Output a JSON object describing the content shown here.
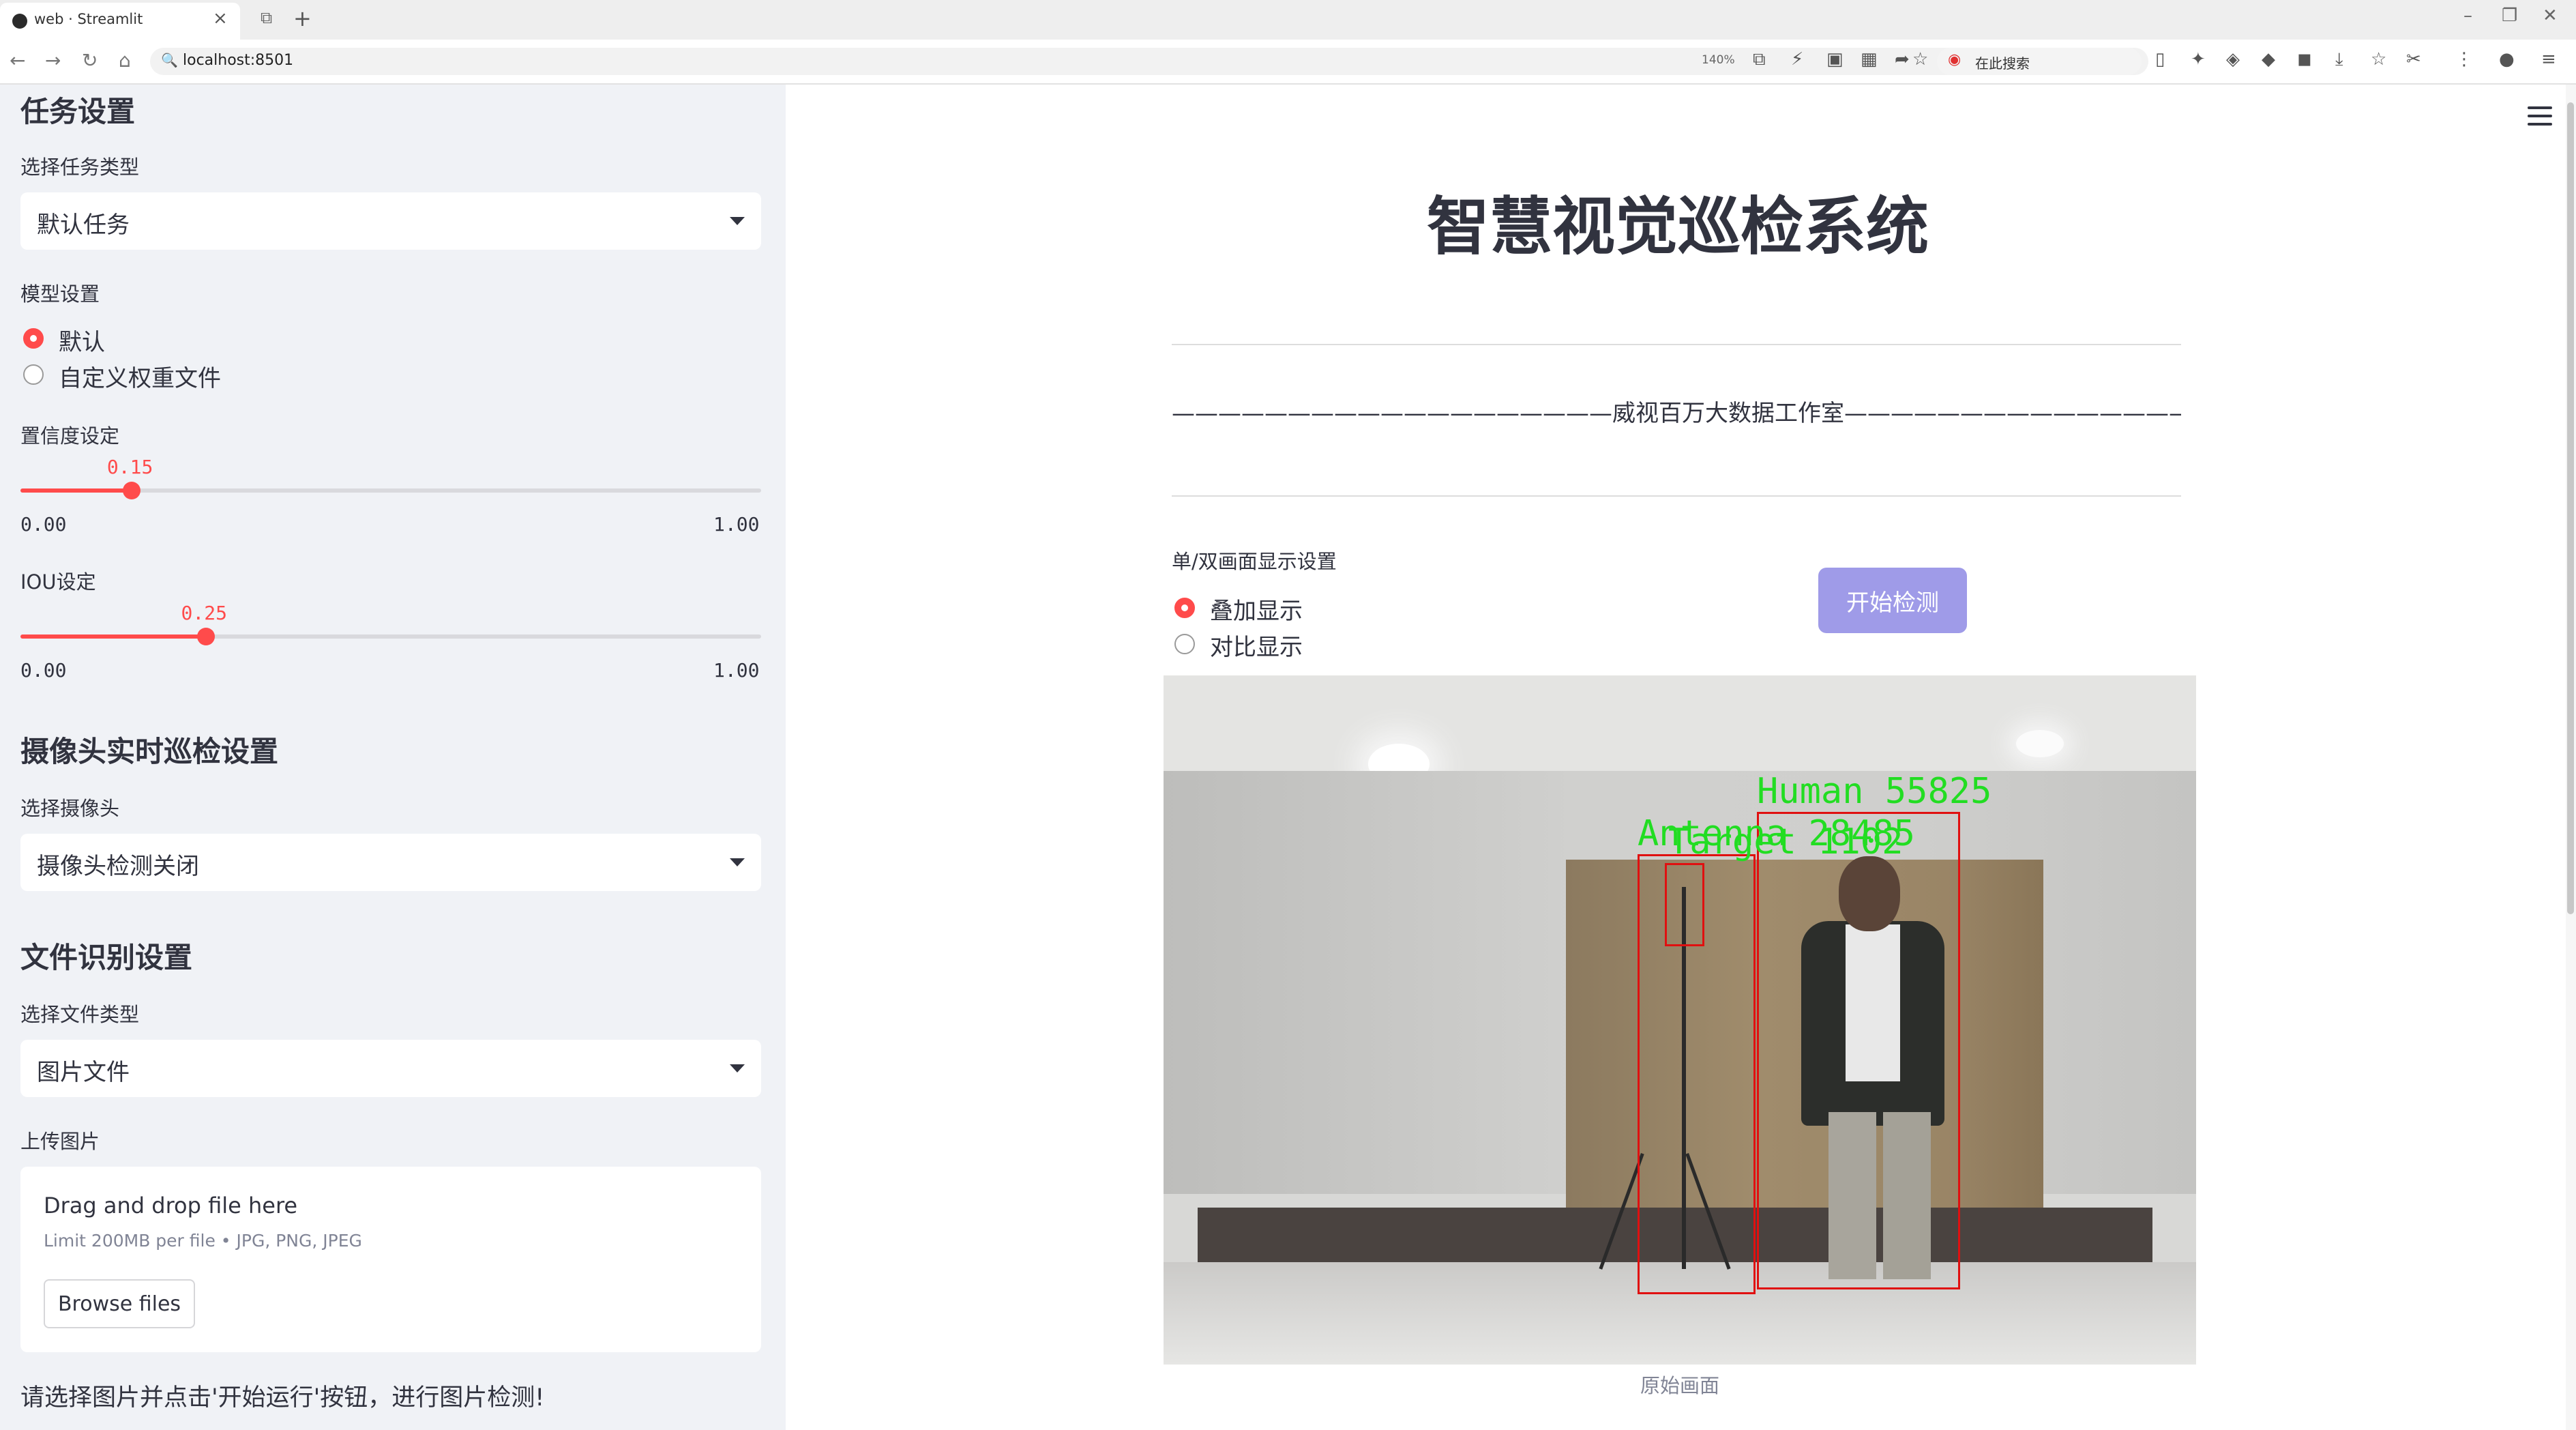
{
  "browser": {
    "tab_title": "web · Streamlit",
    "url": "localhost:8501",
    "zoom": "140%",
    "search_label": "在此搜索"
  },
  "sidebar": {
    "task_settings": {
      "header": "任务设置",
      "label": "选择任务类型",
      "value": "默认任务"
    },
    "model_settings": {
      "label": "模型设置",
      "options": [
        "默认",
        "自定义权重文件"
      ],
      "selected": "默认"
    },
    "confidence": {
      "label": "置信度设定",
      "value": "0.15",
      "min": "0.00",
      "max": "1.00",
      "fraction": 0.15
    },
    "iou": {
      "label": "IOU设定",
      "value": "0.25",
      "min": "0.00",
      "max": "1.00",
      "fraction": 0.25
    },
    "camera": {
      "header": "摄像头实时巡检设置",
      "label": "选择摄像头",
      "value": "摄像头检测关闭"
    },
    "file": {
      "header": "文件识别设置",
      "label": "选择文件类型",
      "value": "图片文件"
    },
    "upload": {
      "label": "上传图片",
      "drop_text": "Drag and drop file here",
      "limit_text": "Limit 200MB per file • JPG, PNG, JPEG",
      "browse_label": "Browse files"
    },
    "hint": "请选择图片并点击'开始运行'按钮，进行图片检测!"
  },
  "main": {
    "title": "智慧视觉巡检系统",
    "subtitle": "———————————————————威视百万大数据工作室——————————————————————",
    "display_mode": {
      "label": "单/双画面显示设置",
      "options": [
        "叠加显示",
        "对比显示"
      ],
      "selected": "叠加显示"
    },
    "start_button": "开始检测",
    "caption": "原始画面",
    "detections": [
      "Human 55825",
      "Antenna 28485",
      "Target 1102"
    ]
  }
}
